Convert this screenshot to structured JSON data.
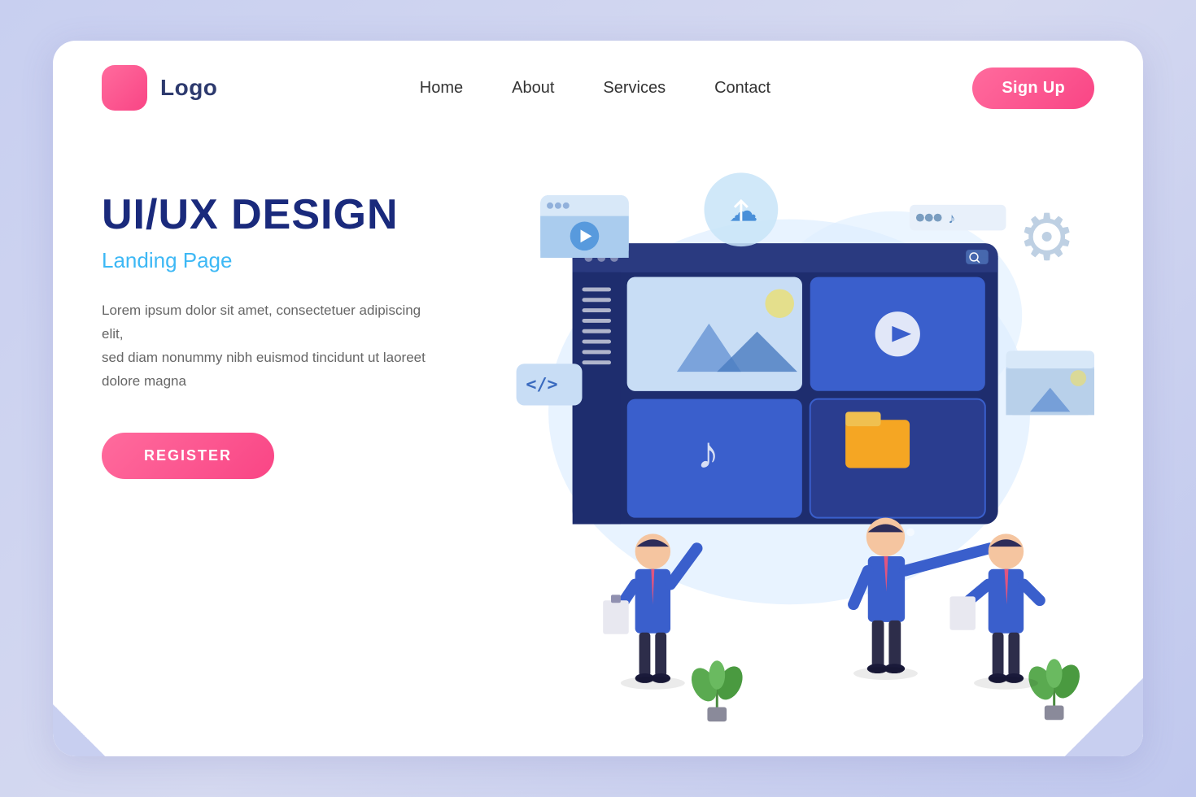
{
  "meta": {
    "page_title": "UI/UX Design Landing Page"
  },
  "navbar": {
    "logo_text": "Logo",
    "links": [
      {
        "label": "Home",
        "id": "home"
      },
      {
        "label": "About",
        "id": "about"
      },
      {
        "label": "Services",
        "id": "services"
      },
      {
        "label": "Contact",
        "id": "contact"
      }
    ],
    "signup_label": "Sign Up"
  },
  "hero": {
    "title": "UI/UX DESIGN",
    "subtitle": "Landing Page",
    "description": "Lorem ipsum dolor sit amet, consectetuer adipiscing elit,\nsed diam nonummy nibh euismod tincidunt ut laoreet\ndolore magna",
    "register_label": "REGISTER"
  },
  "icons": {
    "code_tag": "</>",
    "curly": "{ }",
    "music_note": "♪",
    "gear": "⚙",
    "cloud": "☁"
  },
  "colors": {
    "primary_blue": "#1a2a7c",
    "accent_pink": "#f94585",
    "light_blue": "#3db8f5",
    "monitor_bg": "#1e2d6e",
    "nav_text": "#333333"
  }
}
